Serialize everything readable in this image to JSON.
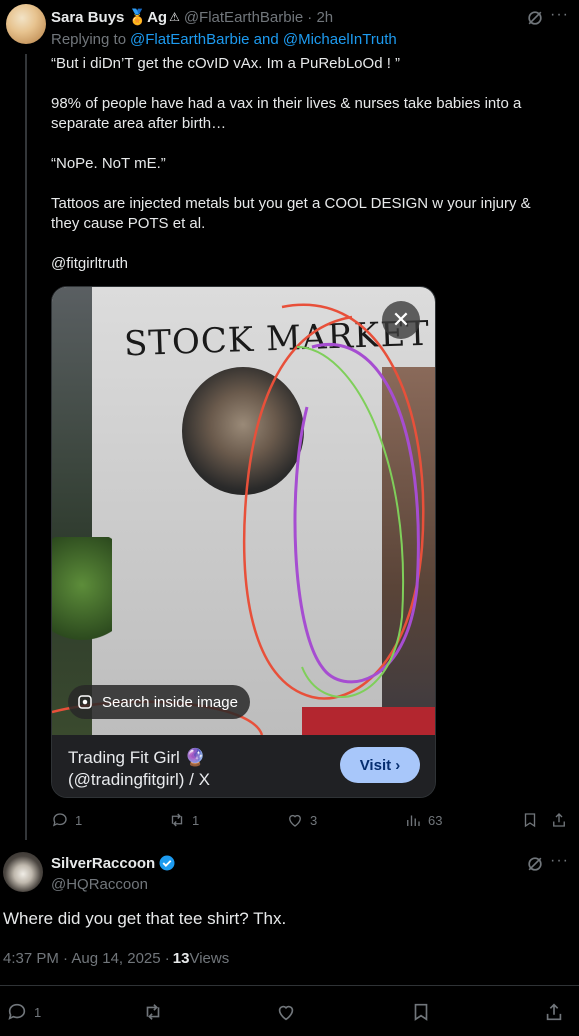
{
  "tweet1": {
    "display_name": "Sara Buys",
    "name_suffix": "Ag",
    "handle": "@FlatEarthBarbie",
    "time": "· 2h",
    "replying_prefix": "Replying to",
    "replying_to": "@FlatEarthBarbie and @MichaelInTruth",
    "paragraphs": [
      "“But i diDn’T get the cOvID vAx. Im a PuRebLoOd ! ”",
      "98% of people have had a vax in their lives & nurses take babies into a separate area after birth…",
      "“NoPe. NoT mE.”",
      "Tattoos are injected metals but you get a COOL DESIGN w your injury & they cause POTS et al."
    ],
    "mention": "@fitgirltruth",
    "card": {
      "shirt_text": "STOCK MARKET",
      "search_label": "Search inside image",
      "title_line1": "Trading Fit Girl 🔮",
      "title_line2": "(@tradingfitgirl) / X",
      "visit_label": "Visit ›"
    },
    "stats": {
      "replies": "1",
      "reposts": "1",
      "likes": "3",
      "views": "63"
    }
  },
  "tweet2": {
    "display_name": "SilverRaccoon",
    "handle": "@HQRaccoon",
    "text": "Where did you get that tee shirt? Thx.",
    "timestamp": "4:37 PM · Aug 14, 2025 · ",
    "views_count": "13",
    "views_label": " Views",
    "stats": {
      "replies": "1"
    }
  },
  "colors": {
    "accent": "#1d9bf0",
    "muted": "#71767b",
    "visit_bg": "#a8c7fa"
  }
}
